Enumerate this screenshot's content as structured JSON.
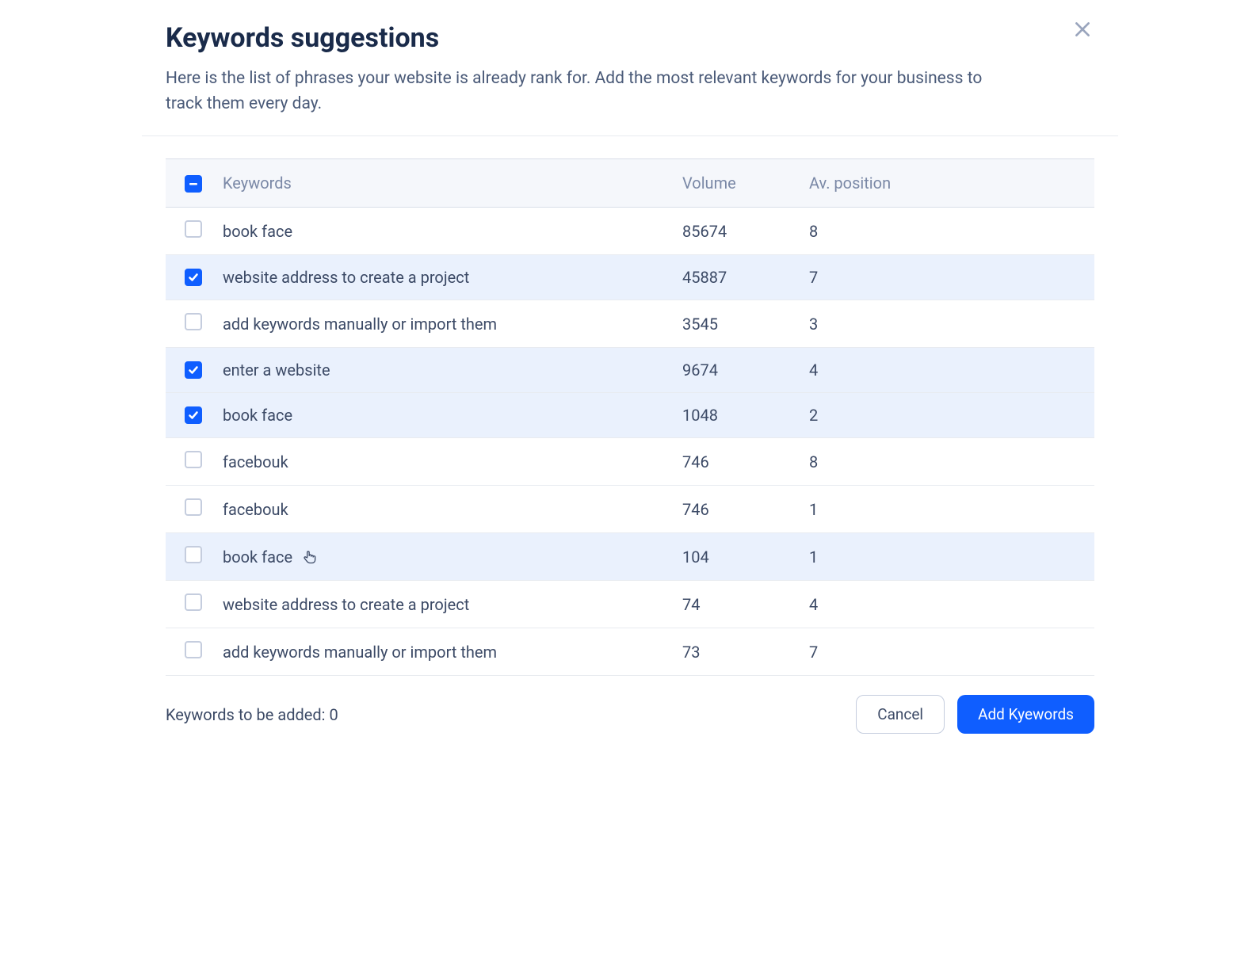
{
  "header": {
    "title": "Keywords suggestions",
    "subtitle": "Here is the list of phrases your website is already rank for. Add the most relevant keywords for your business to track them every day."
  },
  "table": {
    "headers": {
      "keywords": "Keywords",
      "volume": "Volume",
      "position": "Av. position"
    },
    "rows": [
      {
        "keyword": "book face",
        "volume": "85674",
        "position": "8",
        "checked": false,
        "hover": false
      },
      {
        "keyword": "website address to create a project",
        "volume": "45887",
        "position": "7",
        "checked": true,
        "hover": false
      },
      {
        "keyword": "add keywords manually or import them",
        "volume": "3545",
        "position": "3",
        "checked": false,
        "hover": false
      },
      {
        "keyword": "enter a website",
        "volume": "9674",
        "position": "4",
        "checked": true,
        "hover": false
      },
      {
        "keyword": "book face",
        "volume": "1048",
        "position": "2",
        "checked": true,
        "hover": false
      },
      {
        "keyword": "facebouk",
        "volume": "746",
        "position": "8",
        "checked": false,
        "hover": false
      },
      {
        "keyword": "facebouk",
        "volume": "746",
        "position": "1",
        "checked": false,
        "hover": false
      },
      {
        "keyword": "book face",
        "volume": "104",
        "position": "1",
        "checked": false,
        "hover": true
      },
      {
        "keyword": "website address to create a project",
        "volume": "74",
        "position": "4",
        "checked": false,
        "hover": false
      },
      {
        "keyword": "add keywords manually or import them",
        "volume": "73",
        "position": "7",
        "checked": false,
        "hover": false
      }
    ]
  },
  "footer": {
    "status_prefix": "Keywords to be added: ",
    "status_count": "0",
    "cancel": "Cancel",
    "add": "Add Kyewords"
  }
}
